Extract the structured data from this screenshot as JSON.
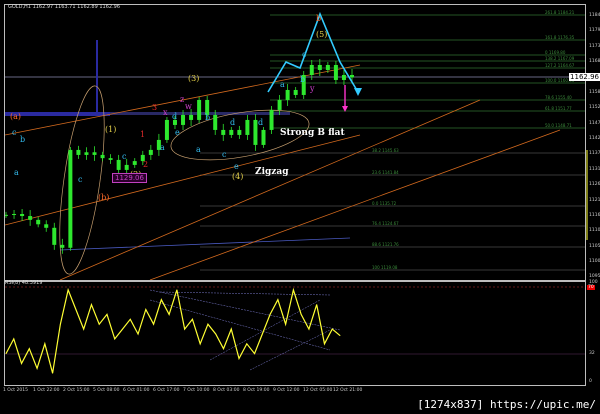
{
  "header": {
    "title": "GOLD,H1  1162.97 1163.71 1162.89 1162.96"
  },
  "rsi_header": {
    "title": "RSI(8) 48.3919"
  },
  "price_axis": [
    "1184.21",
    "1179.06",
    "1173.81",
    "1168.56",
    "1158.06",
    "1152.81",
    "1147.56",
    "1142.21",
    "1137.06",
    "1131.81",
    "1126.56",
    "1121.21",
    "1116.06",
    "1110.81",
    "1105.56",
    "1100.21",
    "1095.06"
  ],
  "current_price": "1162.96",
  "rsi_axis": {
    "top": "100",
    "level_red": "70",
    "level_mid": "32",
    "bottom": "0"
  },
  "time_axis": [
    "1 Oct 2015",
    "1 Oct 22:00",
    "2 Oct 15:00",
    "5 Oct 08:00",
    "6 Oct 01:00",
    "6 Oct 17:00",
    "7 Oct 10:00",
    "8 Oct 03:00",
    "8 Oct 19:00",
    "9 Oct 12:00",
    "12 Oct 05:00",
    "12 Oct 21:00"
  ],
  "fib_levels": [
    "261.8 1184.21",
    "161.8 1176.35",
    "0 1169.80",
    "138.2 1167.09",
    "127.2 1164.67",
    "100.0 1160.33",
    "78.6 1155.40",
    "61.8 1151.77",
    "50.0 1148.71",
    "38.2 1145.63",
    "23.6 1141.84",
    "0.0 1135.72",
    "76.4 1124.67",
    "88.6 1121.76",
    "100 1119.08"
  ],
  "wave_labels": [
    "(a)",
    "(b)",
    "c",
    "b",
    "a",
    "c",
    "(1)",
    "(2)",
    "(3)",
    "(4)",
    "(5)",
    "b",
    "1",
    "2",
    "3",
    "a",
    "b",
    "c",
    "d",
    "e",
    "a",
    "c",
    "d",
    "e",
    "z",
    "w",
    "x",
    "y",
    "a",
    "b",
    "c",
    "d"
  ],
  "annotations": {
    "strong_b_flat": "Strong B flat",
    "zigzag": "Zigzag",
    "price_tag": "1129.06"
  },
  "colors": {
    "candles": "#2ee82e",
    "rsi": "#ffff33",
    "fib": "#2f6f2f",
    "channel": "#d2691e",
    "pattern": "#33ccff",
    "arrow": "#ff33cc"
  },
  "watermark": "[1274x837] https://upic.me/",
  "chart_data": {
    "type": "line",
    "title": "GOLD,H1",
    "series": [
      {
        "name": "GOLD H1 close",
        "values": [
          1116.2,
          1116.5,
          1115.8,
          1114.5,
          1113.0,
          1111.8,
          1106.0,
          1105.0,
          1138.3,
          1136.6,
          1137.5,
          1136.6,
          1135.5,
          1134.9,
          1131.5,
          1133.2,
          1134.5,
          1136.6,
          1138.3,
          1141.7,
          1148.5,
          1146.8,
          1150.2,
          1148.5,
          1155.3,
          1150.2,
          1145.1,
          1143.4,
          1145.1,
          1143.4,
          1148.5,
          1140.0,
          1145.1,
          1151.9,
          1155.3,
          1158.7,
          1157.0,
          1163.8,
          1167.2,
          1165.5,
          1167.2,
          1162.1,
          1163.8,
          1162.96
        ]
      },
      {
        "name": "RSI(8)",
        "values": [
          30,
          45,
          20,
          35,
          15,
          40,
          10,
          60,
          95,
          75,
          55,
          80,
          60,
          70,
          45,
          55,
          65,
          50,
          75,
          60,
          85,
          70,
          95,
          55,
          65,
          40,
          60,
          50,
          35,
          55,
          25,
          40,
          30,
          50,
          70,
          85,
          60,
          95,
          70,
          55,
          80,
          40,
          55,
          48.4
        ]
      }
    ],
    "xlabel": "",
    "ylabel": "",
    "ylim": [
      1095.06,
      1184.21
    ],
    "rsi_ylim": [
      0,
      100
    ],
    "grid": false
  }
}
